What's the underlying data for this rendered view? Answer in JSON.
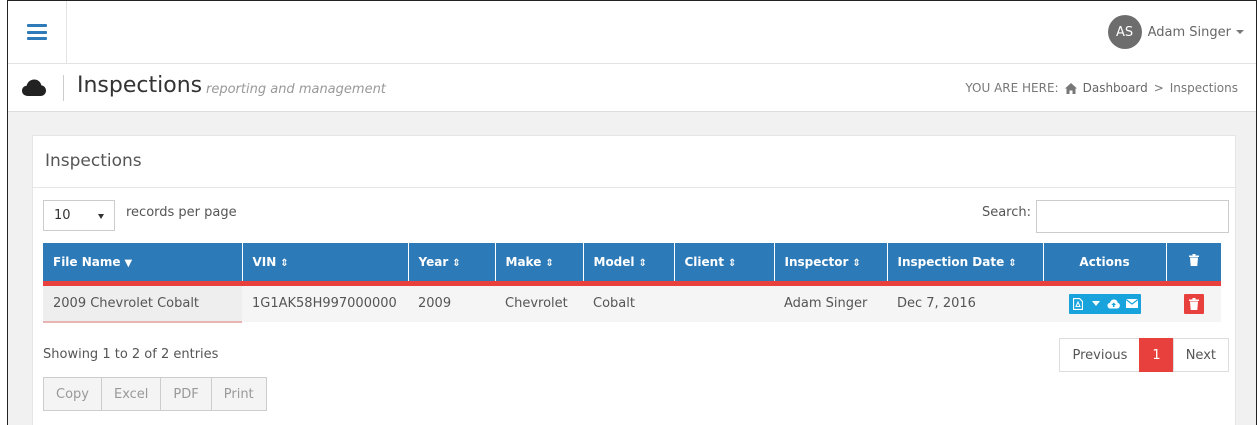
{
  "user": {
    "initials": "AS",
    "name": "Adam Singer"
  },
  "header": {
    "title": "Inspections",
    "subtitle": "reporting and management",
    "breadcrumb": {
      "prefix": "YOU ARE HERE:",
      "home": "Dashboard",
      "separator": ">",
      "current": "Inspections"
    }
  },
  "panel": {
    "title": "Inspections",
    "length": {
      "value": "10",
      "label": "records per page"
    },
    "search": {
      "label": "Search:",
      "value": ""
    }
  },
  "table": {
    "columns": [
      "File Name",
      "VIN",
      "Year",
      "Make",
      "Model",
      "Client",
      "Inspector",
      "Inspection Date",
      "Actions"
    ],
    "rows": [
      {
        "file_name": "2009 Chevrolet Cobalt",
        "vin": "1G1AK58H997000000",
        "year": "2009",
        "make": "Chevrolet",
        "model": "Cobalt",
        "client": "",
        "inspector": "Adam Singer",
        "date": "Dec 7, 2016"
      }
    ]
  },
  "footer": {
    "info": "Showing 1 to 2 of 2 entries",
    "pagination": {
      "previous": "Previous",
      "page": "1",
      "next": "Next"
    },
    "export": [
      "Copy",
      "Excel",
      "PDF",
      "Print"
    ]
  },
  "colors": {
    "primary": "#2c7ab8",
    "accent": "#e8413d",
    "action": "#18a3dc"
  }
}
